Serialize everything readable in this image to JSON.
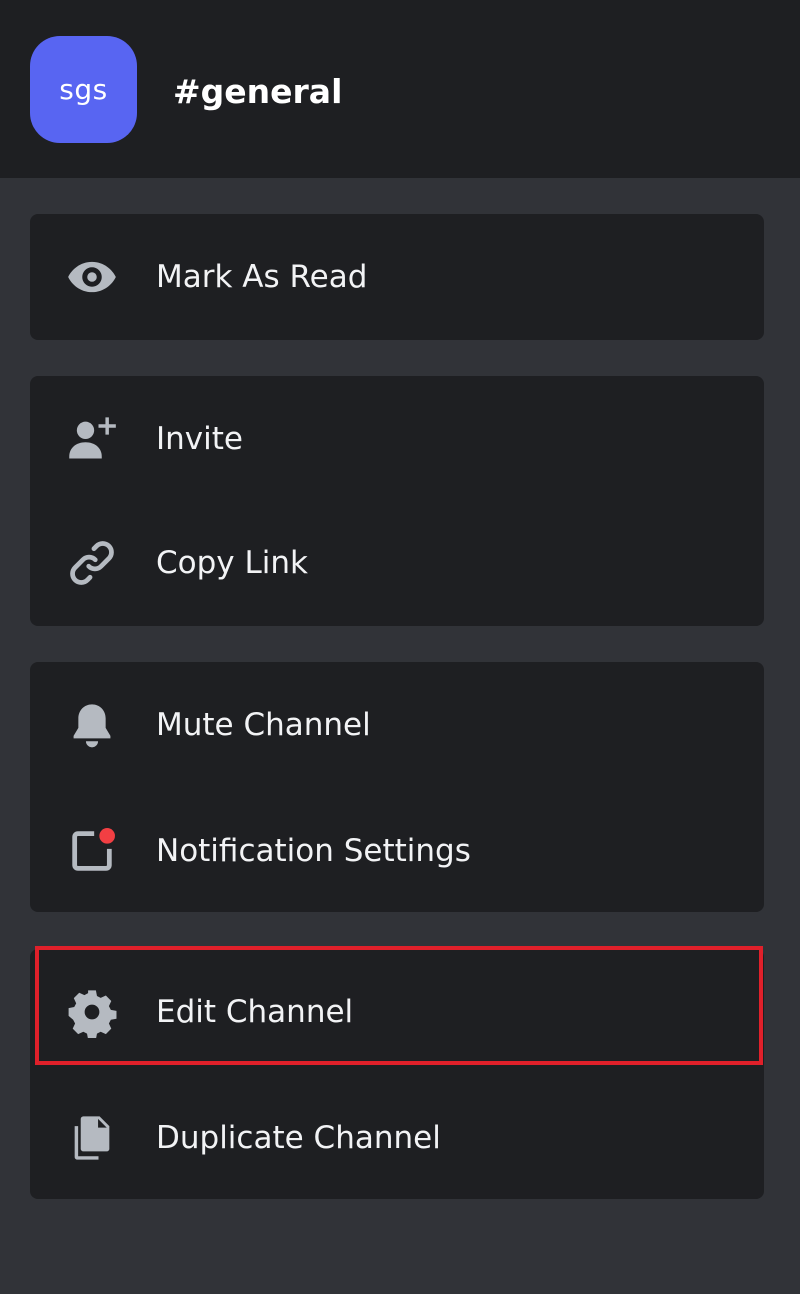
{
  "header": {
    "avatar_text": "sgs",
    "channel_name": "#general"
  },
  "menu": {
    "mark_as_read": "Mark As Read",
    "invite": "Invite",
    "copy_link": "Copy Link",
    "mute_channel": "Mute Channel",
    "notification_settings": "Notification Settings",
    "edit_channel": "Edit Channel",
    "duplicate_channel": "Duplicate Channel"
  },
  "icons": {
    "mark_as_read": "eye-icon",
    "invite": "add-user-icon",
    "copy_link": "link-icon",
    "mute_channel": "bell-icon",
    "notification_settings": "notification-square-icon",
    "edit_channel": "gear-icon",
    "duplicate_channel": "copy-documents-icon"
  },
  "colors": {
    "background": "#313338",
    "panel": "#1e1f22",
    "avatar": "#5865f2",
    "icon": "#b5bac1",
    "notification_dot": "#f23f43",
    "highlight": "#e0202a"
  }
}
